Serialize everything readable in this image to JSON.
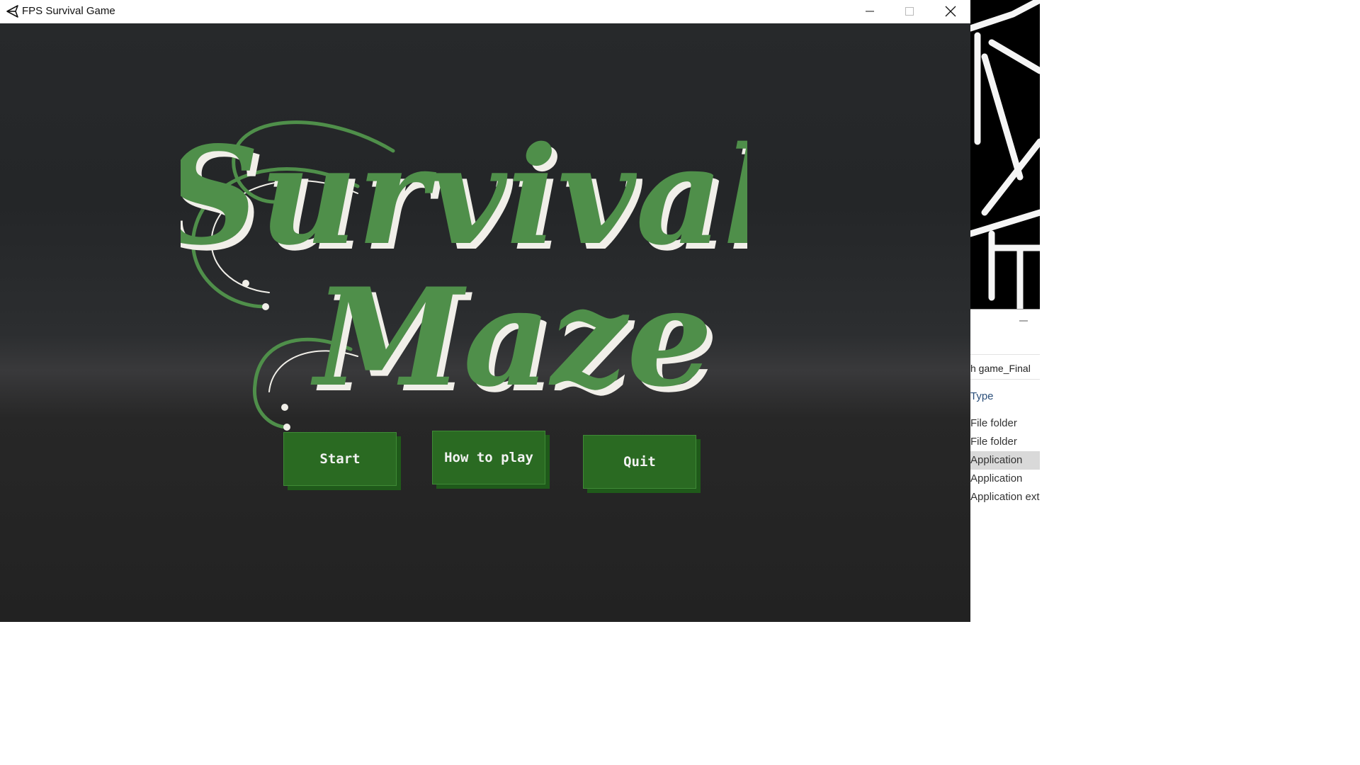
{
  "window": {
    "title": "FPS Survival Game"
  },
  "logo": {
    "line1": "Survival",
    "line2": "Maze",
    "colors": {
      "fill": "#4f8f4a",
      "outline": "#f1efe9",
      "shadow": "#1b2a1a"
    }
  },
  "menu": {
    "start_label": "Start",
    "howto_label": "How to play",
    "quit_label": "Quit",
    "button_color": "#2a6a22"
  },
  "explorer": {
    "address_text": "h game_Final",
    "type_header": "Type",
    "rows": [
      {
        "type": "File folder",
        "selected": false
      },
      {
        "type": "File folder",
        "selected": false
      },
      {
        "type": "Application",
        "selected": true
      },
      {
        "type": "Application",
        "selected": false
      },
      {
        "type": "Application exte",
        "selected": false
      }
    ]
  }
}
